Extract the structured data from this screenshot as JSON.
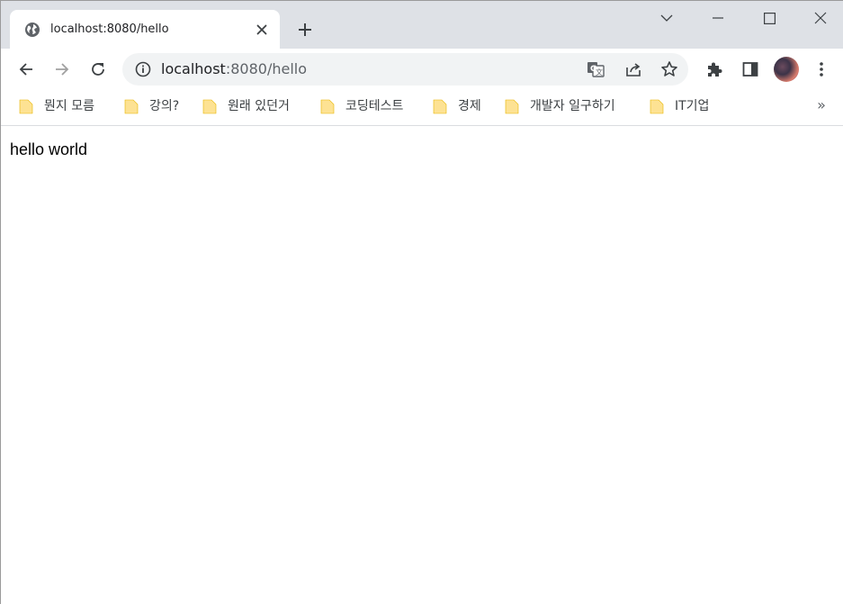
{
  "tab": {
    "title": "localhost:8080/hello",
    "favicon": "globe-icon",
    "close_icon": "close-icon"
  },
  "new_tab_icon": "plus-icon",
  "window_controls": [
    "chevron-down-icon",
    "minimize-icon",
    "maximize-icon",
    "close-icon"
  ],
  "omnibox": {
    "host": "localhost",
    "path": ":8080/hello",
    "icons": [
      "info-icon",
      "translate-icon",
      "share-icon",
      "star-icon"
    ]
  },
  "toolbar_icons": [
    "back-icon",
    "forward-icon",
    "reload-icon",
    "extensions-icon",
    "side-panel-icon",
    "avatar",
    "menu-icon"
  ],
  "bookmarks": [
    {
      "label": "뭔지 모름"
    },
    {
      "label": "강의?"
    },
    {
      "label": "원래 있던거"
    },
    {
      "label": "코딩테스트"
    },
    {
      "label": "경제"
    },
    {
      "label": "개발자 일구하기"
    },
    {
      "label": "IT기업"
    }
  ],
  "bookmarks_more": "»",
  "page": {
    "body_text": "hello world"
  },
  "colors": {
    "tabstrip": "#dee1e6",
    "omnibox": "#f1f3f4",
    "folder": "#fde293",
    "forward_disabled": "#a0a0a0"
  }
}
